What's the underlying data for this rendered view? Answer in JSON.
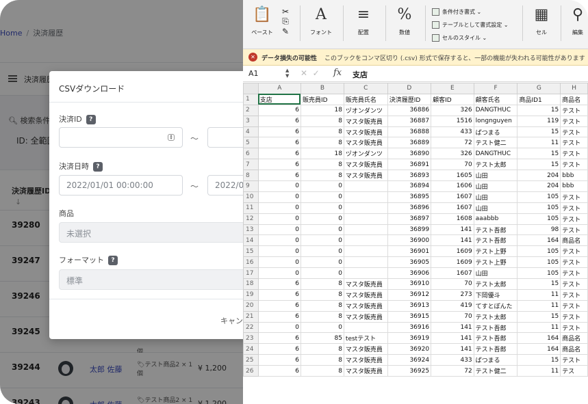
{
  "webapp": {
    "breadcrumb_home": "Home",
    "breadcrumb_sep": "/",
    "breadcrumb_current": "決済履歴",
    "page_title": "決済履歴",
    "filter_label": "検索条件",
    "filter_value": "ID: 全範囲",
    "col_id": "決済履歴ID",
    "sort_arrow": "↓",
    "rows": [
      {
        "id": "39280",
        "user": "",
        "item": "",
        "item2": "",
        "price": ""
      },
      {
        "id": "39247",
        "user": "",
        "item": "",
        "item2": "",
        "price": ""
      },
      {
        "id": "39246",
        "user": "",
        "item": "",
        "item2": "",
        "price": ""
      },
      {
        "id": "39245",
        "user": "",
        "item": "",
        "item2": "個",
        "price": ""
      },
      {
        "id": "39244",
        "user": "太郎 佐藤",
        "item": "テスト商品2 × 1",
        "item2": "個",
        "price": "¥ 1,200"
      },
      {
        "id": "39243",
        "user": "太郎 佐藤",
        "item": "テスト商品2 × 1",
        "item2": "個",
        "price": "¥ 1,200"
      }
    ]
  },
  "modal": {
    "title": "CSVダウンロード",
    "help": "?",
    "tilde": "〜",
    "field_id_label": "決済ID",
    "field_date_label": "決済日時",
    "date_from": "2022/01/01 00:00:00",
    "date_to": "2022/0",
    "field_product_label": "商品",
    "product_value": "未選択",
    "field_format_label": "フォーマット",
    "format_value": "標準",
    "cancel": "キャン"
  },
  "excel": {
    "ribbon": {
      "paste": "ペースト",
      "font": "フォント",
      "align": "配置",
      "number": "数値",
      "cond_format": "条件付き書式 ⌄",
      "table_format": "テーブルとして書式設定 ⌄",
      "cell_style": "セルのスタイル ⌄",
      "cell": "セル",
      "edit": "編集",
      "paste_glyph": "📋",
      "font_glyph": "A",
      "align_glyph": "≡",
      "number_glyph": "%",
      "cell_glyph": "▦",
      "edit_glyph": "⚲"
    },
    "warning_title": "データ損失の可能性",
    "warning_msg": "このブックをコンマ区切り (.csv) 形式で保存すると、一部の機能が失われる可能性があります",
    "cell_ref": "A1",
    "fx": "fx",
    "formula_value": "支店",
    "columns": [
      "A",
      "B",
      "C",
      "D",
      "E",
      "F",
      "G",
      "H"
    ],
    "rows": [
      [
        "支店",
        "販売員ID",
        "販売員氏名",
        "決済履歴ID",
        "顧客ID",
        "顧客氏名",
        "商品ID1",
        "商品名"
      ],
      [
        "6",
        "18",
        "ヅオンダンツ",
        "36886",
        "326",
        "DANGTHUC",
        "15",
        "テスト"
      ],
      [
        "6",
        "8",
        "マスタ販売員",
        "36887",
        "1516",
        "longnguyen",
        "119",
        "テスト"
      ],
      [
        "6",
        "8",
        "マスタ販売員",
        "36888",
        "433",
        "ぱつまる",
        "15",
        "テスト"
      ],
      [
        "6",
        "8",
        "マスタ販売員",
        "36889",
        "72",
        "テスト健二",
        "11",
        "テスト"
      ],
      [
        "6",
        "18",
        "ヅオンダンツ",
        "36890",
        "326",
        "DANGTHUC",
        "15",
        "テスト"
      ],
      [
        "6",
        "8",
        "マスタ販売員",
        "36891",
        "70",
        "テスト太郎",
        "15",
        "テスト"
      ],
      [
        "6",
        "8",
        "マスタ販売員",
        "36893",
        "1605",
        "山田",
        "204",
        "bbb"
      ],
      [
        "0",
        "0",
        "",
        "36894",
        "1606",
        "山田",
        "204",
        "bbb"
      ],
      [
        "0",
        "0",
        "",
        "36895",
        "1607",
        "山田",
        "105",
        "テスト"
      ],
      [
        "0",
        "0",
        "",
        "36896",
        "1607",
        "山田",
        "105",
        "テスト"
      ],
      [
        "0",
        "0",
        "",
        "36897",
        "1608",
        "aaabbb",
        "105",
        "テスト"
      ],
      [
        "0",
        "0",
        "",
        "36899",
        "141",
        "テスト吾郎",
        "98",
        "テスト"
      ],
      [
        "0",
        "0",
        "",
        "36900",
        "141",
        "テスト吾郎",
        "164",
        "商品名"
      ],
      [
        "0",
        "0",
        "",
        "36901",
        "1609",
        "テスト上野",
        "105",
        "テスト"
      ],
      [
        "0",
        "0",
        "",
        "36905",
        "1609",
        "テスト上野",
        "105",
        "テスト"
      ],
      [
        "0",
        "0",
        "",
        "36906",
        "1607",
        "山田",
        "105",
        "テスト"
      ],
      [
        "6",
        "8",
        "マスタ販売員",
        "36910",
        "70",
        "テスト太郎",
        "15",
        "テスト"
      ],
      [
        "6",
        "8",
        "マスタ販売員",
        "36912",
        "273",
        "下岡優斗",
        "11",
        "テスト"
      ],
      [
        "6",
        "8",
        "マスタ販売員",
        "36913",
        "419",
        "てすとぽんた",
        "11",
        "テスト"
      ],
      [
        "6",
        "8",
        "マスタ販売員",
        "36915",
        "70",
        "テスト太郎",
        "15",
        "テスト"
      ],
      [
        "0",
        "0",
        "",
        "36916",
        "141",
        "テスト吾郎",
        "11",
        "テスト"
      ],
      [
        "6",
        "85",
        "testテスト",
        "36919",
        "141",
        "テスト吾郎",
        "164",
        "商品名"
      ],
      [
        "6",
        "8",
        "マスタ販売員",
        "36920",
        "141",
        "テスト吾郎",
        "164",
        "商品名"
      ],
      [
        "6",
        "8",
        "マスタ販売員",
        "36924",
        "433",
        "ぱつまる",
        "15",
        "テスト"
      ],
      [
        "6",
        "8",
        "マスタ販売員",
        "36925",
        "72",
        "テスト健二",
        "11",
        "テス"
      ]
    ]
  }
}
